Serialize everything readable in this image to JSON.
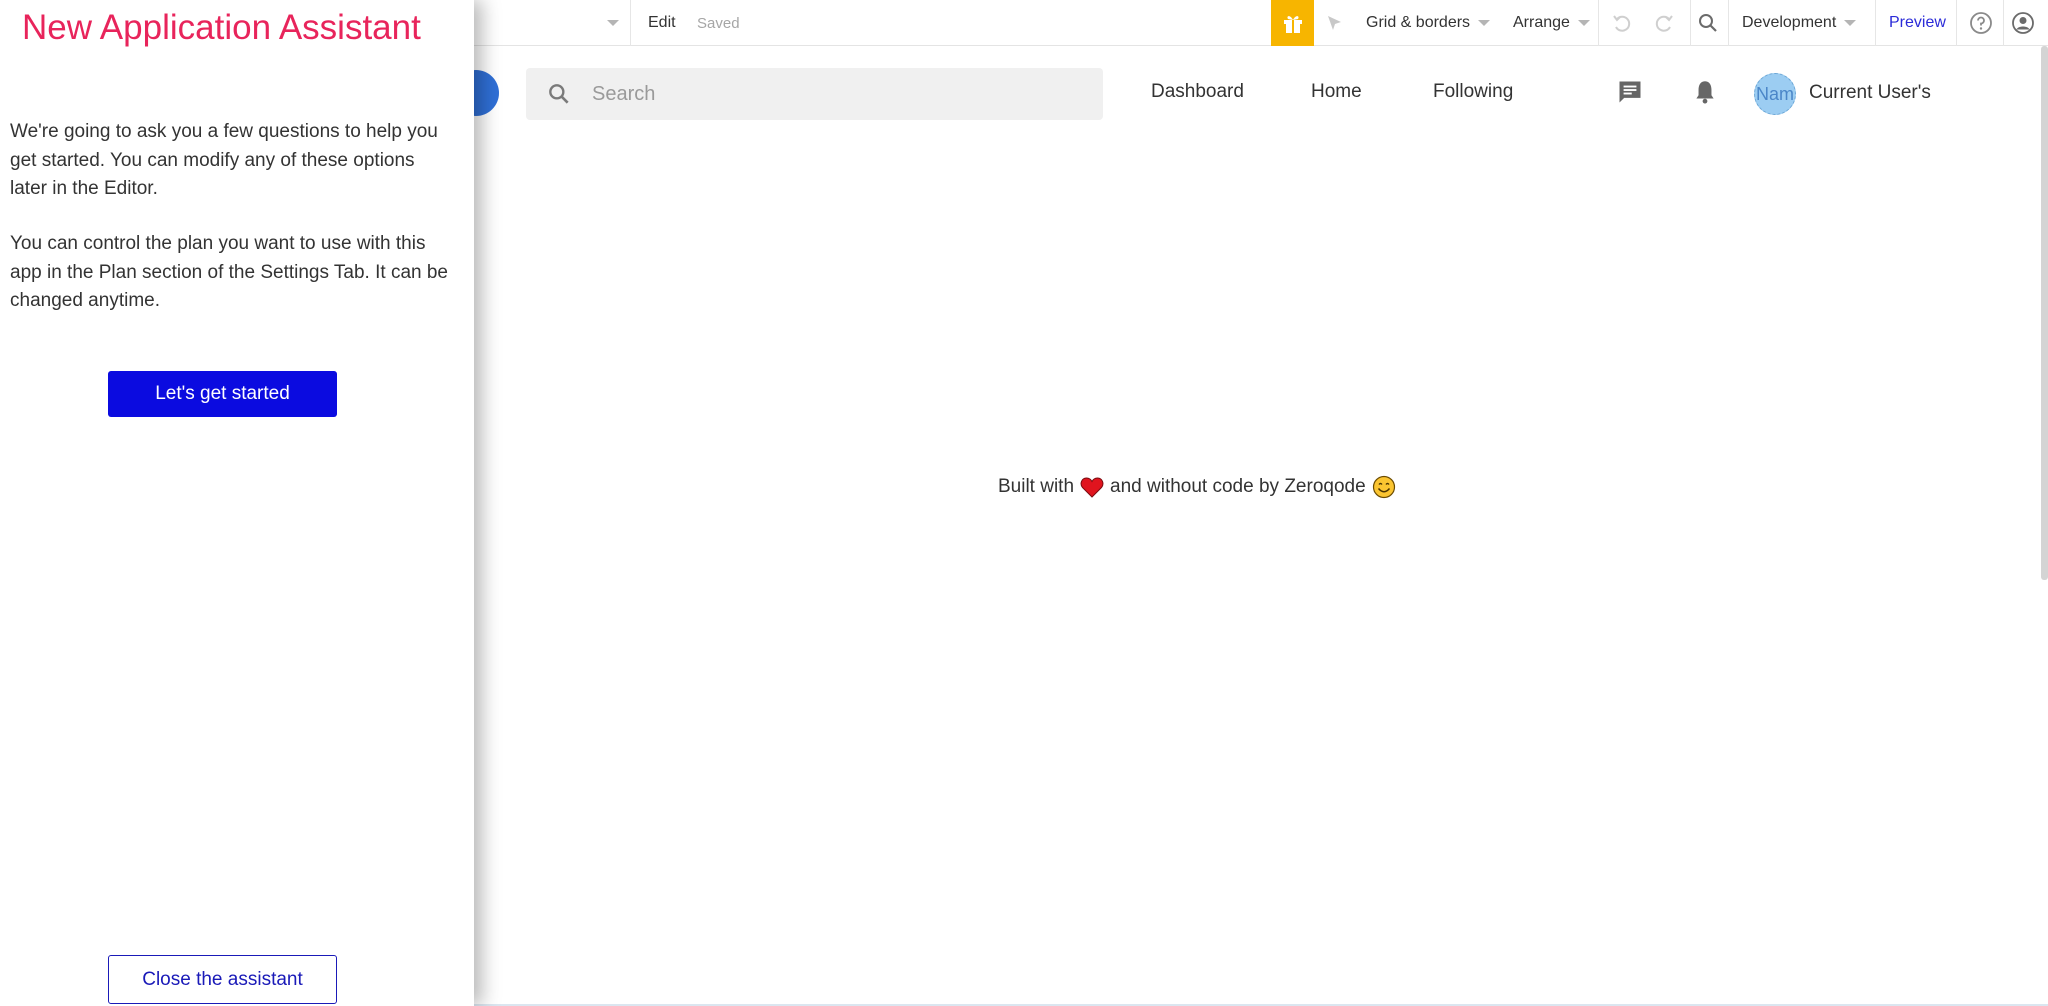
{
  "toolbar": {
    "page_dropdown": "",
    "edit": "Edit",
    "saved": "Saved",
    "grid_borders": "Grid & borders",
    "arrange": "Arrange",
    "environment": "Development",
    "preview": "Preview",
    "gift_color": "#f7b500"
  },
  "app_header": {
    "search_placeholder": "Search",
    "nav": [
      "Dashboard",
      "Home",
      "Following"
    ],
    "avatar_text": "Nam",
    "user_name": "Current User's"
  },
  "footer": {
    "before_heart": "Built with",
    "after_heart": "and without code by Zeroqode"
  },
  "assistant": {
    "title": "New Application Assistant",
    "paragraph_1": "We're going to ask you a few questions to help you get started. You can modify any of these options later in the Editor.",
    "paragraph_2": "You can control the plan you want to use with this app in the Plan section of the Settings Tab. It can be changed anytime.",
    "start_button": "Let's get started",
    "close_button": "Close the assistant",
    "title_color": "#e8245b",
    "button_color": "#0b0be0"
  }
}
